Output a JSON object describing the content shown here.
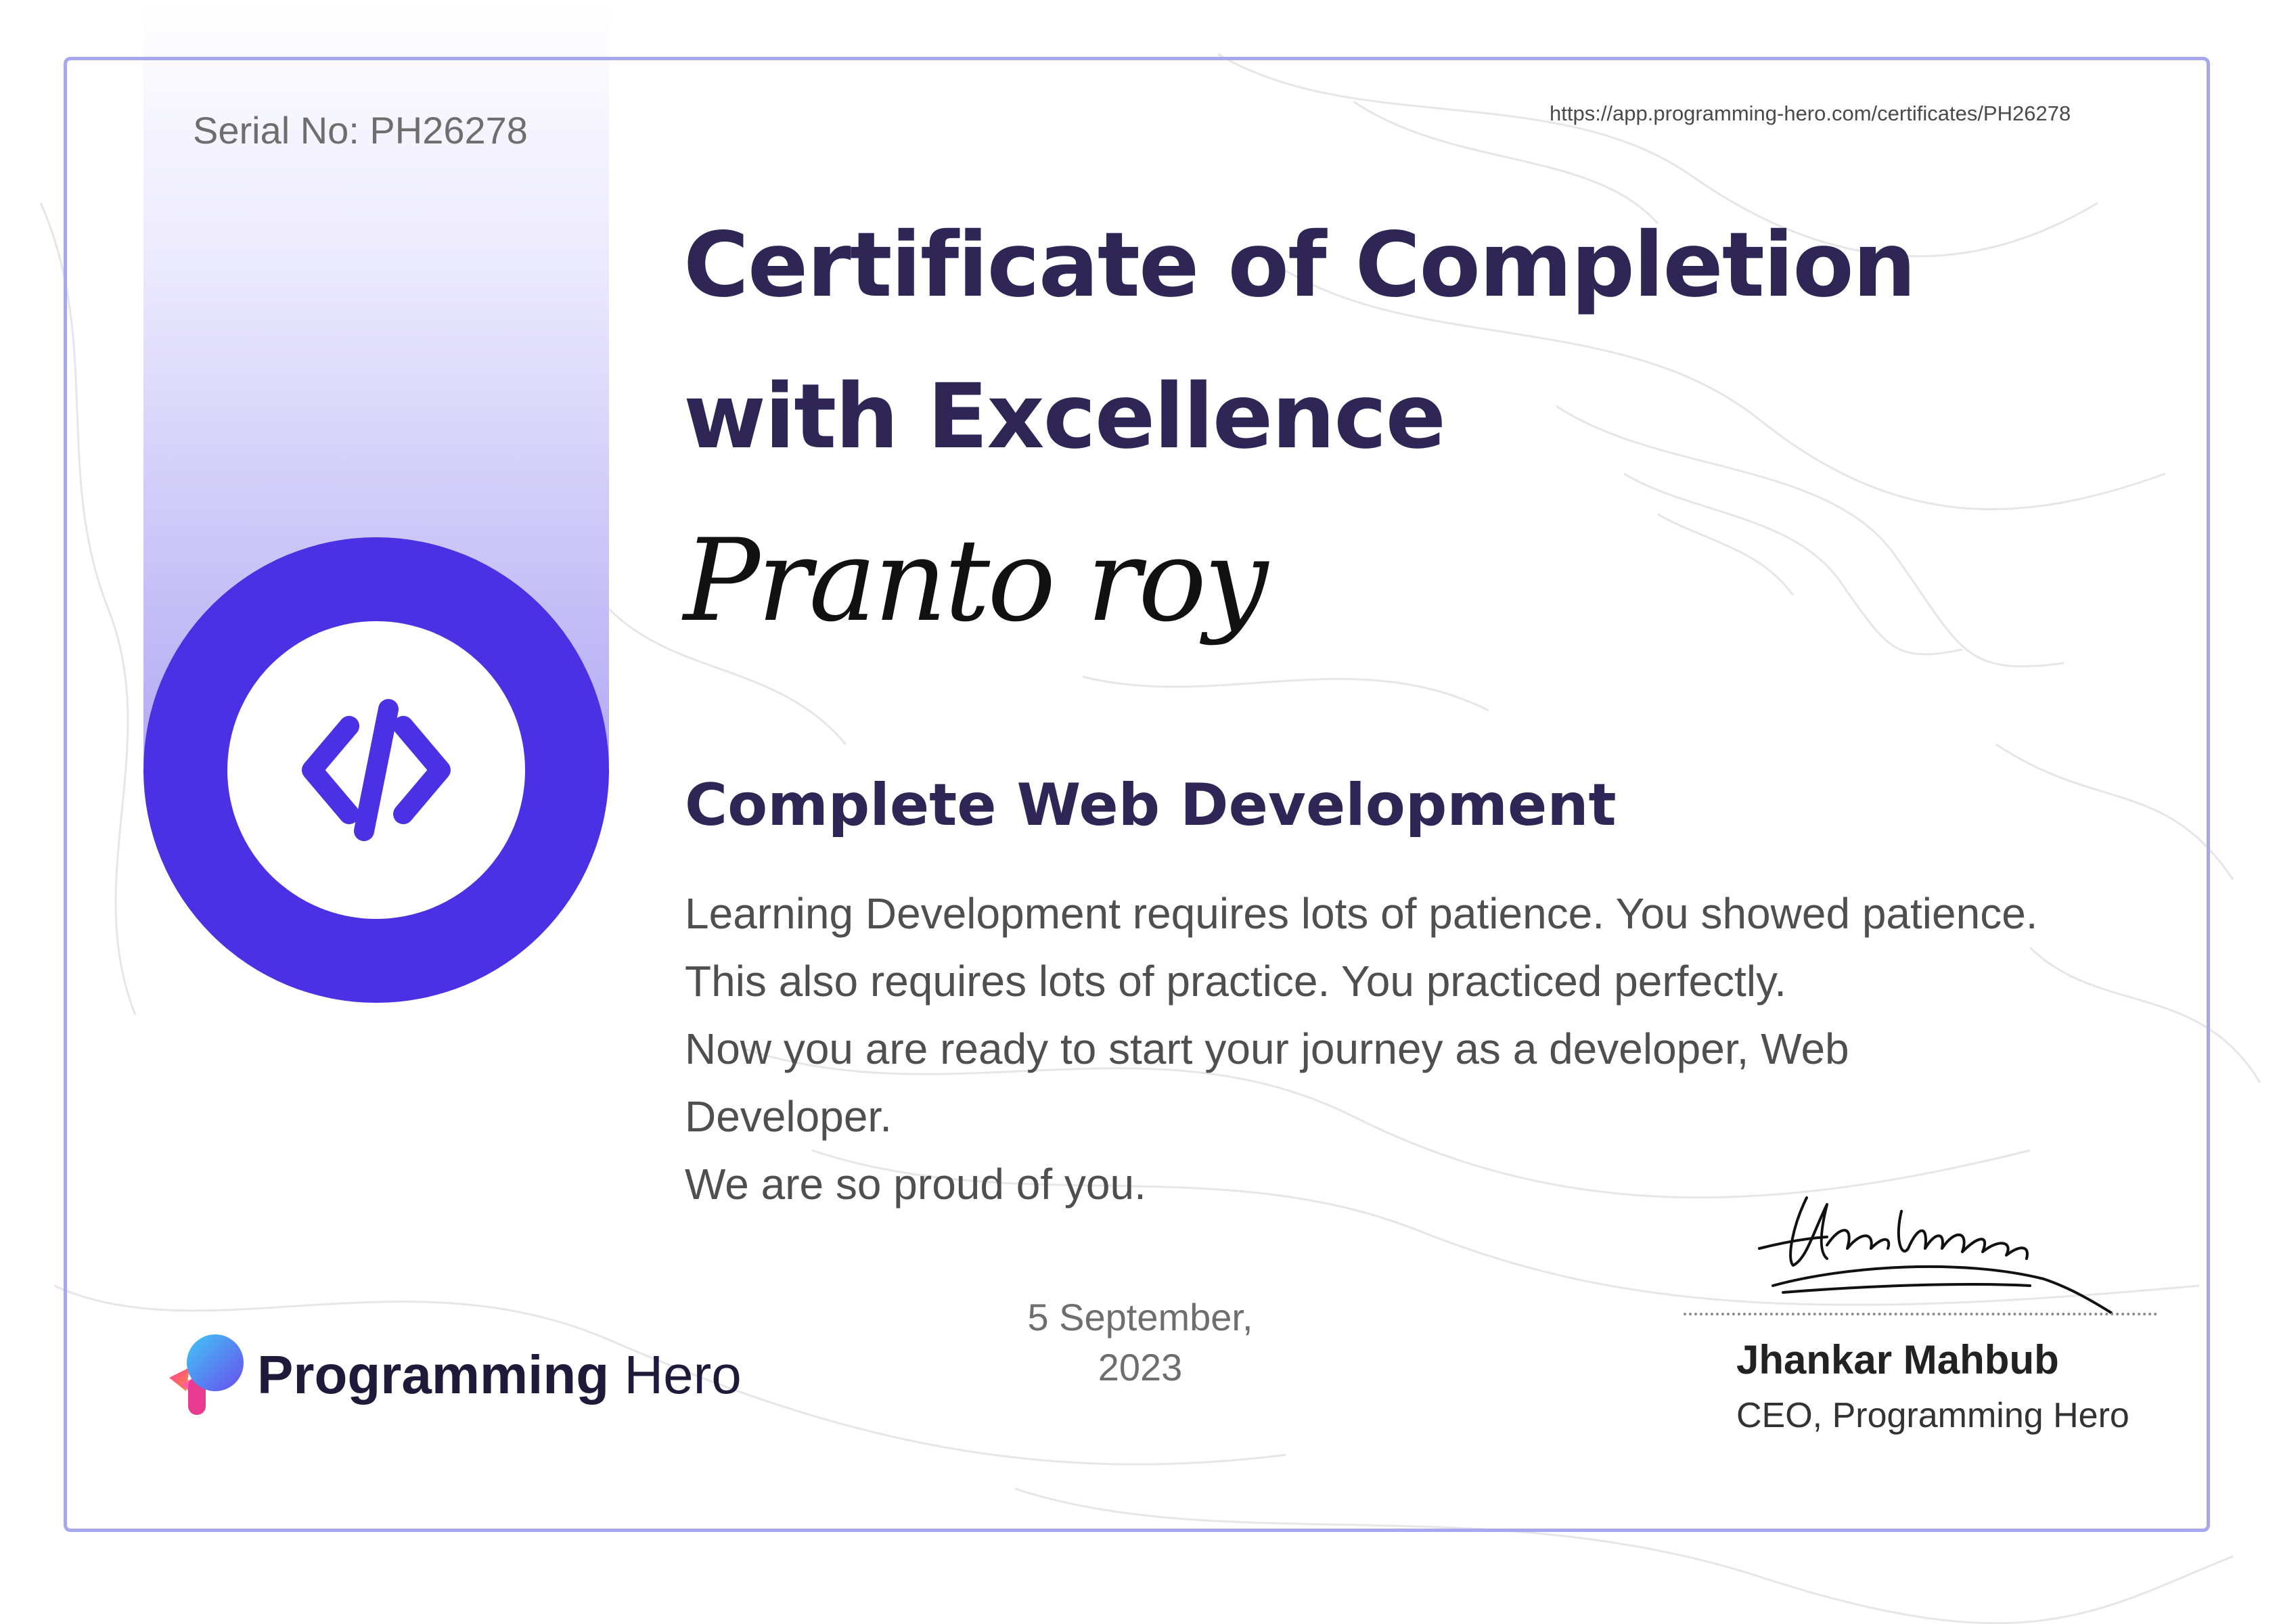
{
  "certificate": {
    "serial": "Serial No: PH26278",
    "url": "https://app.programming-hero.com/certificates/PH26278",
    "title_line1": "Certificate of Completion",
    "title_line2": "with Excellence",
    "recipient": "Pranto roy",
    "course": "Complete Web Development",
    "body_lines": [
      "Learning Development requires lots of patience. You showed patience.",
      "This also requires lots of practice. You practiced perfectly.",
      "Now you are ready to start your journey as a developer, Web",
      "Developer.",
      "We are so proud of you."
    ],
    "date_line1": "5 September,",
    "date_line2": "2023"
  },
  "brand": {
    "name_part1": "Programming",
    "name_part2": "Hero",
    "logo_icon": "programming-hero-logo-icon",
    "badge_icon": "code-brackets-icon"
  },
  "signer": {
    "name": "Jhankar Mahbub",
    "role": "CEO, Programming Hero",
    "signature_icon": "handwritten-signature-icon"
  },
  "colors": {
    "title": "#2f2656",
    "accent": "#4a31e3",
    "frame": "#a5a7f0"
  }
}
